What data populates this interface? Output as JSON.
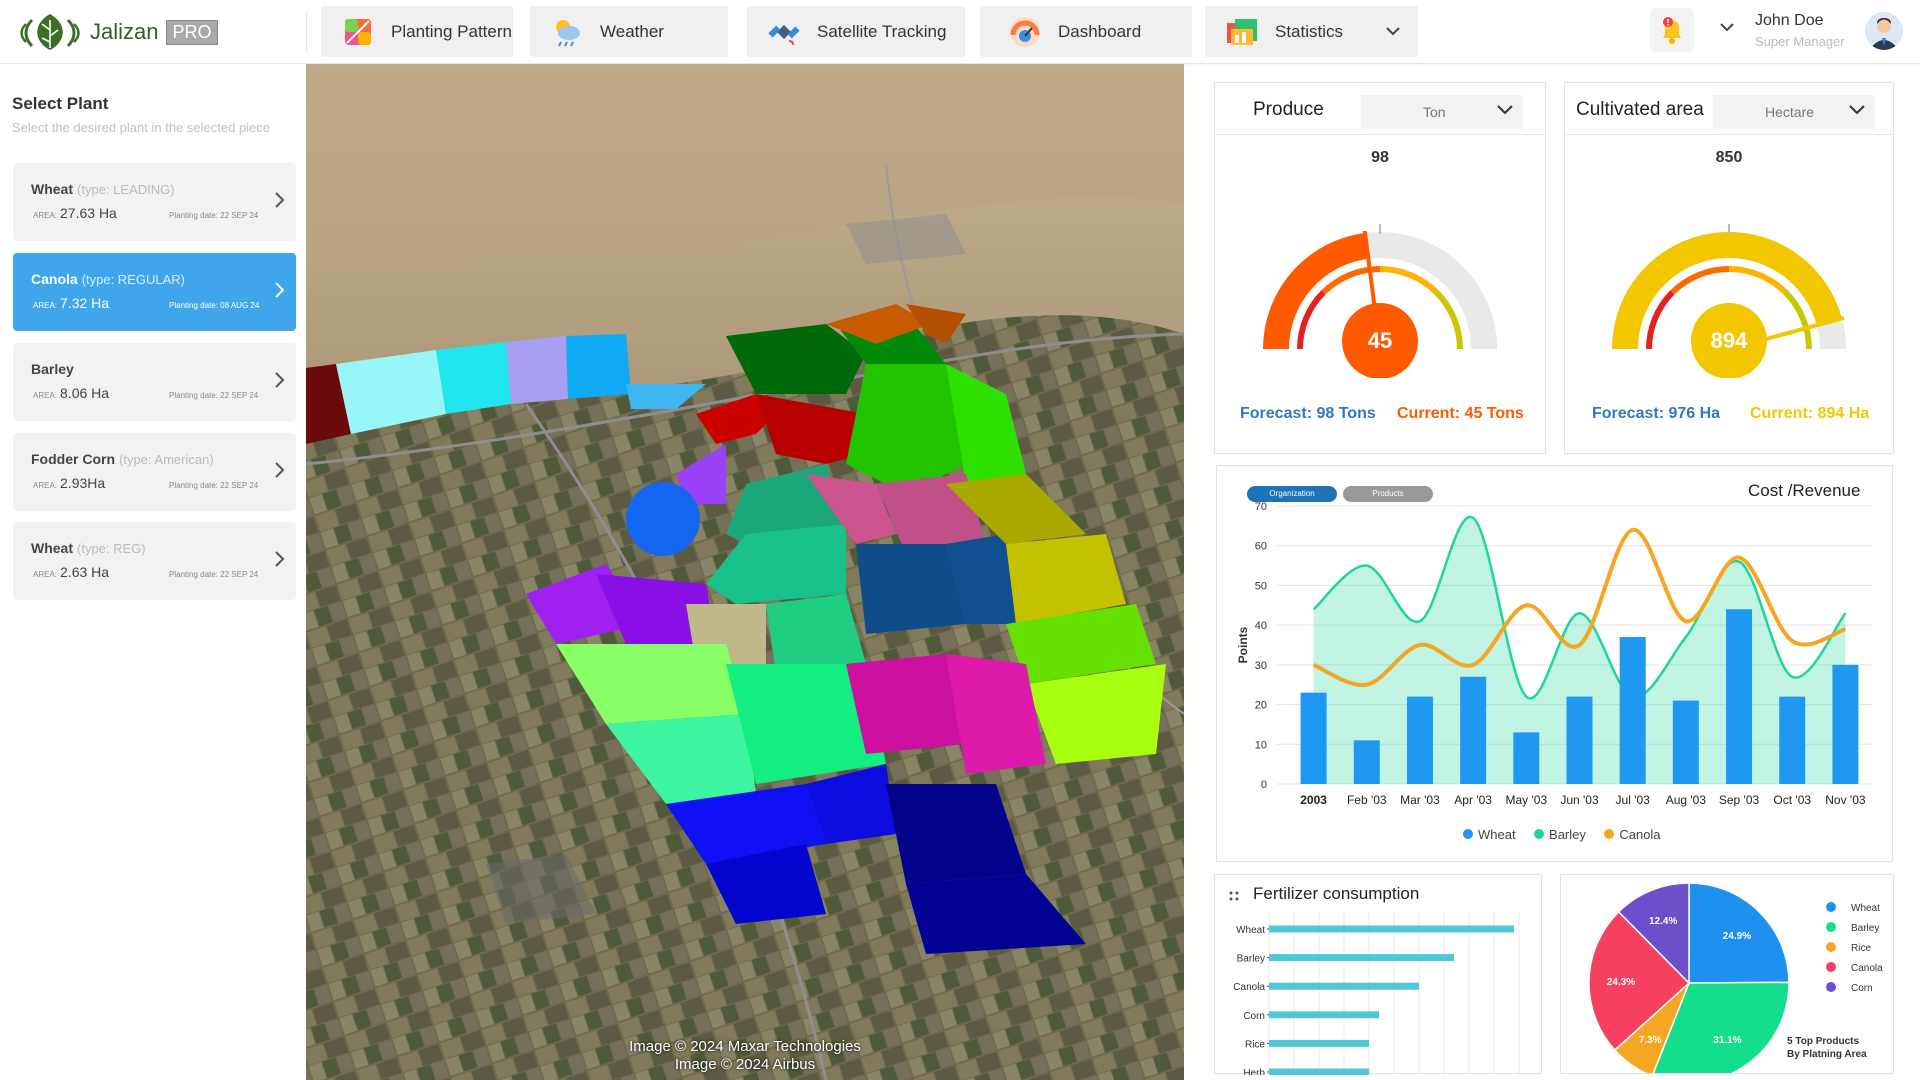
{
  "app": {
    "name": "Jalizan",
    "badge": "PRO"
  },
  "nav": [
    {
      "label": "Planting Pattern",
      "icon": "planting-pattern-icon"
    },
    {
      "label": "Weather",
      "icon": "weather-icon"
    },
    {
      "label": "Satellite Tracking",
      "icon": "satellite-icon"
    },
    {
      "label": "Dashboard",
      "icon": "dashboard-icon"
    },
    {
      "label": "Statistics",
      "icon": "statistics-icon"
    }
  ],
  "user": {
    "name": "John Doe",
    "role": "Super Manager"
  },
  "left": {
    "title": "Select Plant",
    "subtitle": "Select the desired plant in the selected piece",
    "area_label": "AREA:",
    "plants": [
      {
        "name": "Wheat",
        "type": "(type: LEADING)",
        "area": "27.63 Ha",
        "date": "Planting date: 22 SEP 24",
        "active": false
      },
      {
        "name": "Canola",
        "type": "(type: REGULAR)",
        "area": "7.32 Ha",
        "date": "Planting date: 08 AUG 24",
        "active": true
      },
      {
        "name": "Barley",
        "type": "",
        "area": "8.06 Ha",
        "date": "Planting date: 22 SEP 24",
        "active": false
      },
      {
        "name": "Fodder Corn",
        "type": "(type: American)",
        "area": "2.93Ha",
        "date": "Planting date: 22 SEP 24",
        "active": false
      },
      {
        "name": "Wheat",
        "type": "(type: REG)",
        "area": "2.63 Ha",
        "date": "Planting date: 22 SEP 24",
        "active": false
      }
    ]
  },
  "map": {
    "credit1": "Image © 2024 Maxar Technologies",
    "credit2": "Image © 2024 Airbus"
  },
  "produce": {
    "title": "Produce",
    "unit": "Ton",
    "max_label": "98",
    "current": 45,
    "forecast": 98,
    "forecast_text": "Forecast: 98 Tons",
    "current_text": "Current: 45 Tons",
    "current_display": "45",
    "color": "#ff5a00"
  },
  "cultivated": {
    "title": "Cultivated area",
    "unit": "Hectare",
    "max_label": "850",
    "current": 894,
    "forecast": 976,
    "forecast_text": "Forecast: 976 Ha",
    "current_text": "Current: 894 Ha",
    "current_display": "894",
    "color": "#f2c700"
  },
  "cost_revenue": {
    "title": "Cost /Revenue",
    "pills": [
      "Organization",
      "Products"
    ],
    "chart_data": {
      "type": "bar",
      "ylabel": "Points",
      "ylim": [
        0,
        70
      ],
      "yticks": [
        0,
        10,
        20,
        30,
        40,
        50,
        60,
        70
      ],
      "categories": [
        "2003",
        "Feb '03",
        "Mar '03",
        "Apr '03",
        "May '03",
        "Jun '03",
        "Jul '03",
        "Aug '03",
        "Sep '03",
        "Oct '03",
        "Nov '03"
      ],
      "series": [
        {
          "name": "Wheat",
          "kind": "bar",
          "color": "#1e98f0",
          "values": [
            23,
            11,
            22,
            27,
            13,
            22,
            37,
            21,
            44,
            22,
            30
          ]
        },
        {
          "name": "Barley",
          "kind": "area",
          "color": "#1fd69a",
          "values": [
            44,
            55,
            41,
            67,
            22,
            43,
            22,
            37,
            56,
            27,
            43
          ]
        },
        {
          "name": "Canola",
          "kind": "line",
          "color": "#f5a623",
          "values": [
            30,
            25,
            35,
            30,
            45,
            35,
            64,
            41,
            57,
            36,
            39
          ]
        }
      ]
    }
  },
  "fertilizer": {
    "title": "Fertilizer consumption",
    "chart_data": {
      "type": "bar",
      "orientation": "horizontal",
      "categories": [
        "Wheat",
        "Barley",
        "Canola",
        "Corn",
        "Rice",
        "Herb"
      ],
      "values": [
        98,
        74,
        60,
        44,
        40,
        40
      ],
      "color": "#4ec7d6"
    }
  },
  "pie": {
    "caption1": "5 Top Products",
    "caption2": "By Platning Area",
    "chart_data": {
      "type": "pie",
      "categories": [
        "Wheat",
        "Barley",
        "Rice",
        "Canola",
        "Corn"
      ],
      "values": [
        24.9,
        31.1,
        7.3,
        24.3,
        12.4
      ],
      "labels": [
        "24.9%",
        "31.1%",
        "7.3%",
        "24.3%",
        "12.4%"
      ],
      "colors": [
        "#1e90f0",
        "#13de8c",
        "#f5a623",
        "#f5405f",
        "#6d4fcc"
      ]
    }
  }
}
